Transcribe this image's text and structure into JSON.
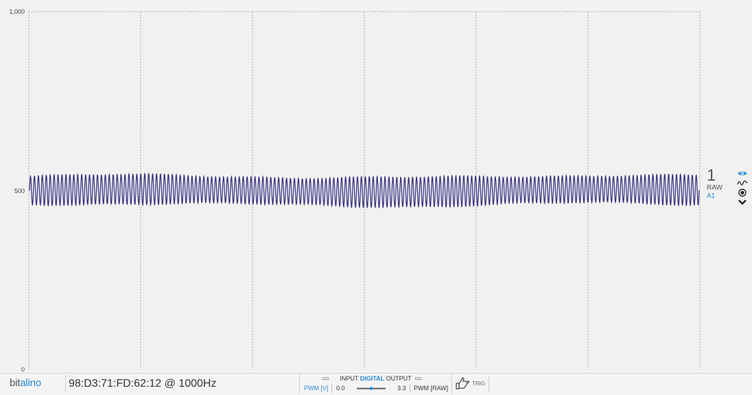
{
  "plot": {
    "y_ticks": [
      "1,000",
      "500",
      "0"
    ],
    "signal_color": "#3a3480",
    "grid_color": "#9a9a9a"
  },
  "chart_data": {
    "type": "line",
    "title": "",
    "xlabel": "",
    "ylabel": "",
    "ylim": [
      0,
      1000
    ],
    "grid": true,
    "series": [
      {
        "center": 500,
        "amplitude": 40,
        "cycles": 170
      }
    ]
  },
  "channel": {
    "number": "1",
    "mode": "RAW",
    "name": "A1",
    "icons": [
      "eye-icon",
      "waveform-icon",
      "radio-target-icon",
      "chevron-down-icon"
    ]
  },
  "footer": {
    "logo_part1": "bit",
    "logo_part2": "alino",
    "device": "98:D3:71:FD:62:12 @ 1000Hz",
    "dio": {
      "input_label": "INPUT",
      "digital_label": "DIGITAL",
      "output_label": "OUTPUT",
      "pwm_v_label": "PWM [V]",
      "pwm_min": "0.0",
      "pwm_max": "3.3",
      "pwm_raw_label": "PWM [RAW]",
      "pwm_value_fraction": 0.5
    },
    "trig_label": "TRIG"
  }
}
